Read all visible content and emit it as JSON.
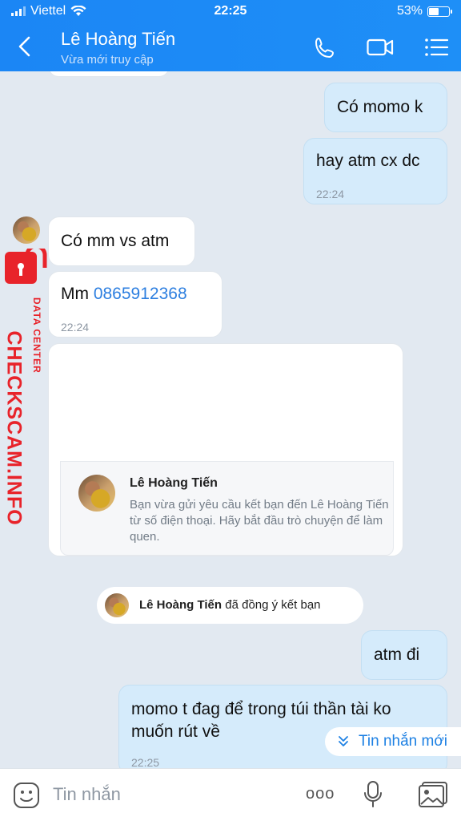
{
  "status_bar": {
    "carrier": "Viettel",
    "time": "22:25",
    "battery": "53%",
    "battery_level": 0.53
  },
  "header": {
    "name": "Lê Hoàng Tiến",
    "subtitle": "Vừa mới truy cập",
    "icons": [
      "back-icon",
      "phone-icon",
      "video-icon",
      "menu-icon"
    ]
  },
  "messages": [
    {
      "dir": "out",
      "text": "Có momo k"
    },
    {
      "dir": "out",
      "text": "hay atm cx dc",
      "time": "22:24"
    },
    {
      "dir": "in",
      "text": "Có mm vs atm"
    },
    {
      "dir": "in",
      "text_prefix": "Mm ",
      "phone": "0865912368",
      "time": "22:24"
    },
    {
      "dir": "out",
      "text": "atm đi"
    },
    {
      "dir": "out",
      "text": "momo t đag để trong túi thần tài ko muốn rút về",
      "line1": "momo t đag để trong túi thần tài ko",
      "line2": "muốn rút về",
      "time": "22:25"
    }
  ],
  "friend_card": {
    "name": "Lê Hoàng Tiến",
    "description": "Bạn vừa gửi yêu cầu kết bạn đến Lê Hoàng Tiến từ số điện thoại. Hãy bắt đầu trò chuyện để làm quen."
  },
  "system_notice": {
    "name": "Lê Hoàng Tiến",
    "text": " đã đồng ý kết bạn"
  },
  "new_message_pill": {
    "label": "Tin nhắn mới"
  },
  "watermark": {
    "main": "CHECKSCAM.INFO",
    "sub": "DATA CENTER"
  },
  "composer": {
    "placeholder": "Tin nhắn",
    "more": "ooo"
  },
  "colors": {
    "header": "#1b86f5",
    "outgoing": "#d5ebfb",
    "incoming": "#ffffff",
    "link": "#2d7fe0",
    "watermark": "#e8232a"
  }
}
